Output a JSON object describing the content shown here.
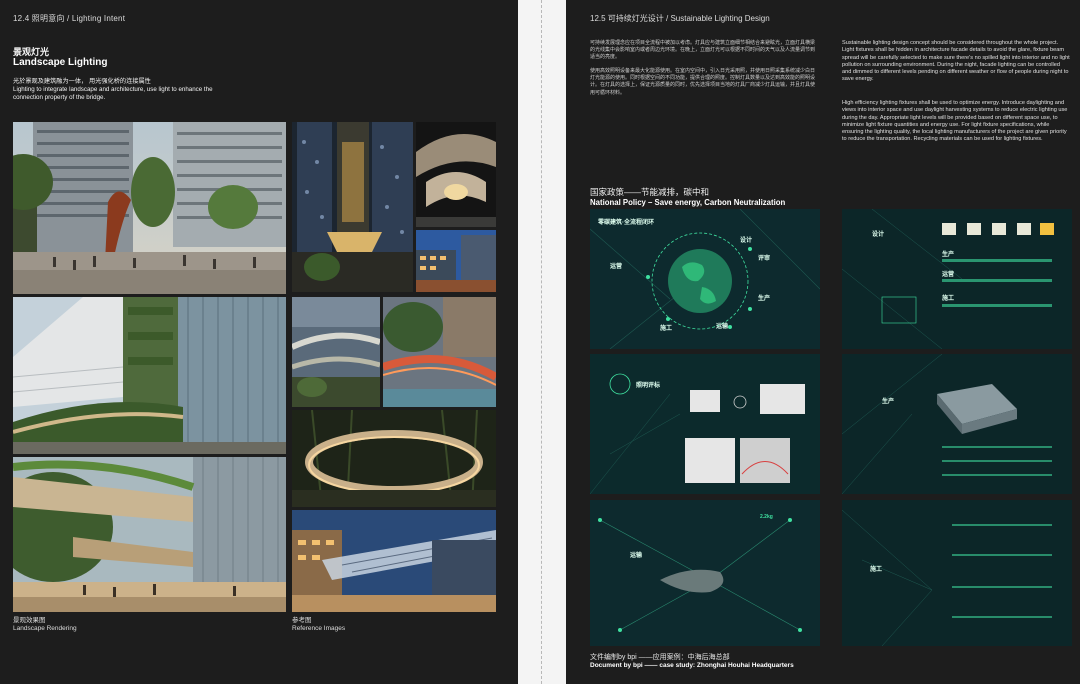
{
  "left_page": {
    "header": "12.4 照明意向 / Lighting Intent",
    "section_title_cn": "景观灯光",
    "section_title_en": "Landscape Lighting",
    "intro_lines": [
      "光於景观及建筑融为一体，  用光强化桥的连接属性",
      "Lighting to integrate landscape and architecture, use light to enhance the",
      "connection property of the bridge."
    ],
    "captions": {
      "left_cn": "景观效果图",
      "left_en": "Landscape Rendering",
      "right_cn": "参考图",
      "right_en": "Reference Images"
    }
  },
  "right_page": {
    "header": "12.5 可持续灯光设计 / Sustainable Lighting Design",
    "cn_para_1": "可持续发展理念应在项目全流程中被加以考虑。灯具应与建筑立面细节相结合来避眩光，立面灯具横梁的光线集中会影响室内或者周边光环境。在晚上，立面灯光可以根据不同时间的天气以及人流量调节到适当的亮度。",
    "cn_para_2": "使用高效照明设备来最大化能源使用。在室内空间中，引入日光采用照，并使用日照采集系统减少白日灯光能源的使用。同时根据空间的不同功能，提供合理的照度。控制灯具数量以及达到高效能的照明设计。在灯具的选择上，保证光源质量的同时，优先选择项目当地的灯具厂商减少灯具运输，并且灯具使用可循环材料。",
    "en_para_1": "Sustainable lighting design concept should be considered throughout the whole project. Light fixtures shall be hidden in architecture facade details to avoid the glare, fixture beam spread will be carefully selected to make sure there's no spilled light into interior and no light pollution on surrounding environment. During the night, facade lighting can be controlled and dimmed to different levels pending on different weather or flow of people during night to save energy.",
    "en_para_2": "High efficiency lighting fixtures shall be used to optimize energy. Introduce daylighting and views into interior space and use daylight harvesting systems to reduce electric lighting use during the day. Appropriate light levels will be provided based on different space use, to minimize light fixture quantities and energy use. For light fixture specifications, while ensuring the lighting quality, the local lighting manufacturers of the project are given priority to reduce the transportation. Recycling materials can be used for lighting fixtures.",
    "policy_title_cn": "国家政策——节能减排，碳中和",
    "policy_title_en": "National Policy – Save energy, Carbon Neutralization",
    "panels": [
      {
        "labels": [
          "零碳建筑·全流程闭环",
          "设计",
          "运营",
          "评审",
          "生产",
          "施工",
          "运输"
        ]
      },
      {
        "labels": [
          "设计",
          "生产",
          "运营",
          "施工"
        ]
      },
      {
        "labels": [
          "照明评标"
        ]
      },
      {
        "labels": [
          "生产"
        ]
      },
      {
        "labels": [
          "运输",
          "2.2kg"
        ]
      },
      {
        "labels": [
          "施工"
        ]
      }
    ],
    "footer_cn": "文件编制by bpi ——应用案例：中海后海总部",
    "footer_en": "Document by bpi —— case study: Zhonghai Houhai Headquarters"
  },
  "colors": {
    "page_bg": "#1d1d1d",
    "panel_bg": "#0d2a2e",
    "accent_green": "#3fe0a0"
  }
}
